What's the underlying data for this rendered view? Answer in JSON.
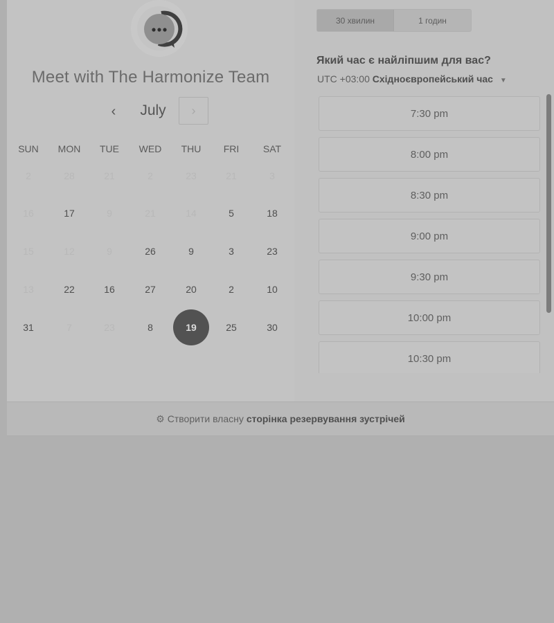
{
  "header": {
    "title": "Meet with The Harmonize Team",
    "avatar_icon": "chat-bubble-icon"
  },
  "calendar": {
    "month": "July",
    "prev_symbol": "‹",
    "next_symbol": "›",
    "weekdays": [
      "SUN",
      "MON",
      "TUE",
      "WED",
      "THU",
      "FRI",
      "SAT"
    ],
    "weeks": [
      [
        {
          "d": "2",
          "faded": true
        },
        {
          "d": "28",
          "faded": true
        },
        {
          "d": "21",
          "faded": true
        },
        {
          "d": "2",
          "faded": true
        },
        {
          "d": "23",
          "faded": true
        },
        {
          "d": "21",
          "faded": true
        },
        {
          "d": "3",
          "faded": true
        }
      ],
      [
        {
          "d": "16",
          "faded": true
        },
        {
          "d": "17",
          "faded": false
        },
        {
          "d": "9",
          "faded": true
        },
        {
          "d": "21",
          "faded": true
        },
        {
          "d": "14",
          "faded": true
        },
        {
          "d": "5",
          "faded": false
        },
        {
          "d": "18",
          "faded": false
        }
      ],
      [
        {
          "d": "15",
          "faded": true
        },
        {
          "d": "12",
          "faded": true
        },
        {
          "d": "9",
          "faded": true
        },
        {
          "d": "26",
          "faded": false
        },
        {
          "d": "9",
          "faded": false
        },
        {
          "d": "3",
          "faded": false
        },
        {
          "d": "23",
          "faded": false
        }
      ],
      [
        {
          "d": "13",
          "faded": true
        },
        {
          "d": "22",
          "faded": false
        },
        {
          "d": "16",
          "faded": false
        },
        {
          "d": "27",
          "faded": false
        },
        {
          "d": "20",
          "faded": false
        },
        {
          "d": "2",
          "faded": false
        },
        {
          "d": "10",
          "faded": false
        }
      ],
      [
        {
          "d": "31",
          "faded": false
        },
        {
          "d": "7",
          "faded": true
        },
        {
          "d": "23",
          "faded": true
        },
        {
          "d": "8",
          "faded": false
        },
        {
          "d": "19",
          "faded": false,
          "selected": true
        },
        {
          "d": "25",
          "faded": false
        },
        {
          "d": "30",
          "faded": false
        }
      ]
    ]
  },
  "durations": {
    "active": "30 хвилин",
    "inactive": "1 годин"
  },
  "slots_panel": {
    "question": "Який час є найліпшим для вас?",
    "timezone_offset": "UTC +03:00",
    "timezone_name": "Східноєвропейський час",
    "slots": [
      "7:30 pm",
      "8:00 pm",
      "8:30 pm",
      "9:00 pm",
      "9:30 pm",
      "10:00 pm",
      "10:30 pm"
    ]
  },
  "footer": {
    "prefix": "Створити власну",
    "link": "сторінка резервування зустрічей",
    "icon": "hubspot-sprocket-icon"
  }
}
